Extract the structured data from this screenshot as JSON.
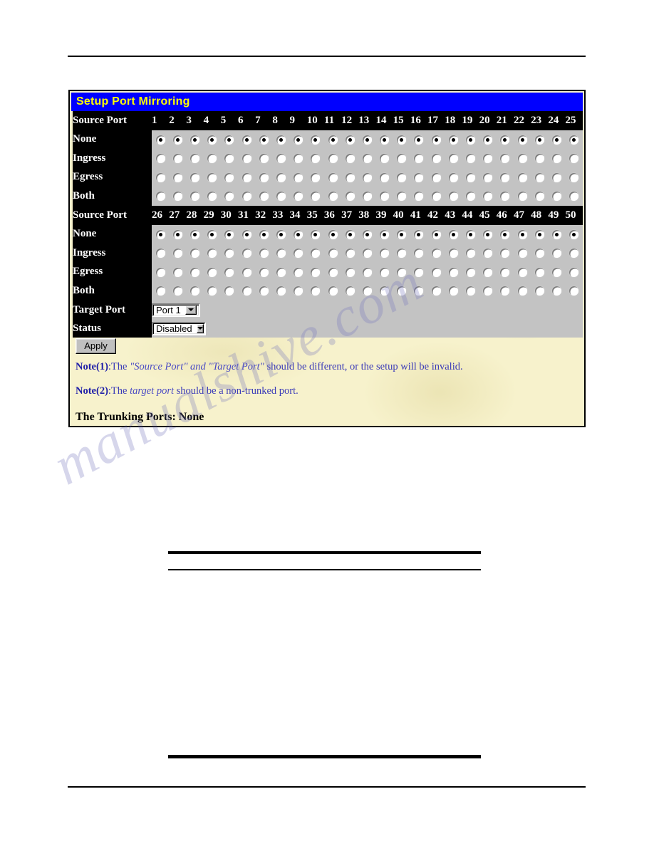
{
  "panel": {
    "title": "Setup Port Mirroring",
    "header_label": "Source Port",
    "mode_rows": [
      "None",
      "Ingress",
      "Egress",
      "Both"
    ],
    "selected_mode": "None",
    "port_groups": [
      [
        1,
        2,
        3,
        4,
        5,
        6,
        7,
        8,
        9,
        10,
        11,
        12,
        13,
        14,
        15,
        16,
        17,
        18,
        19,
        20,
        21,
        22,
        23,
        24,
        25
      ],
      [
        26,
        27,
        28,
        29,
        30,
        31,
        32,
        33,
        34,
        35,
        36,
        37,
        38,
        39,
        40,
        41,
        42,
        43,
        44,
        45,
        46,
        47,
        48,
        49,
        50
      ]
    ]
  },
  "controls": {
    "target_port_label": "Target Port",
    "target_port_value": "Port 1",
    "status_label": "Status",
    "status_value": "Disabled",
    "apply_label": "Apply"
  },
  "notes": {
    "note1_tag": "Note(1)",
    "note1_lead": ":The ",
    "note1_em1": "\"Source Port\" and \"Target Port\"",
    "note1_tail": " should be different, or the setup will be invalid.",
    "note2_tag": "Note(2)",
    "note2_lead": ":The ",
    "note2_em1": "target port",
    "note2_tail": " should be a non-trunked port.",
    "trunking": "The Trunking Ports: None"
  },
  "watermark": {
    "text": "manualshive.com"
  },
  "colors": {
    "title_bar_bg": "#0000ff",
    "title_bar_fg": "#ffff00",
    "panel_bg": "#f7f2cc",
    "row_label_bg": "#000000",
    "radio_cell_bg": "#c3c3c3",
    "note_fg": "#2b2bb5"
  }
}
